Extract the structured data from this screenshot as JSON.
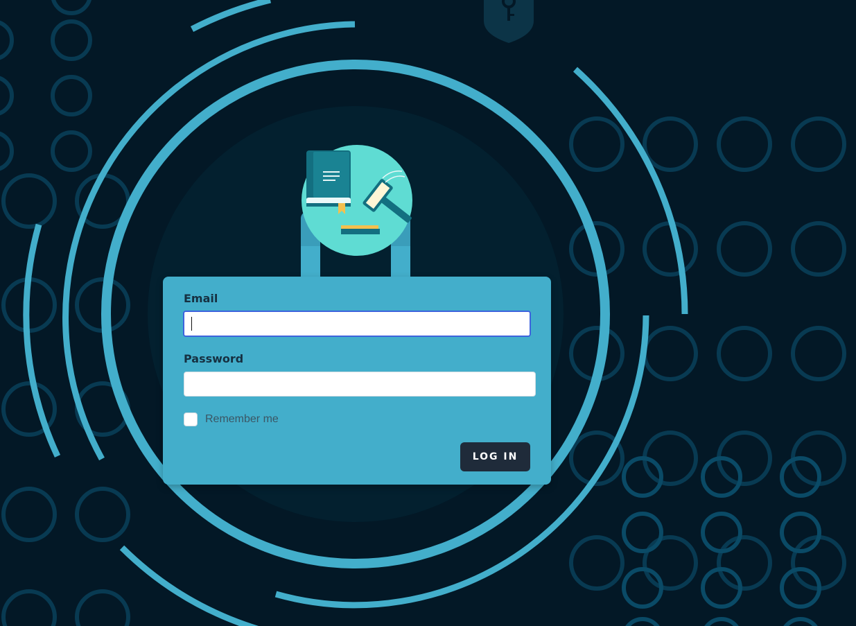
{
  "form": {
    "email_label": "Email",
    "email_value": "",
    "password_label": "Password",
    "password_value": "",
    "remember_label": "Remember me",
    "remember_checked": false,
    "login_label": "LOG IN"
  },
  "icons": {
    "emblem": "law-book-gavel-icon",
    "shield": "shield-key-icon"
  },
  "colors": {
    "background": "#031826",
    "accent": "#43aecb",
    "button": "#1f2b3a",
    "focus_border": "#3d63dd"
  }
}
